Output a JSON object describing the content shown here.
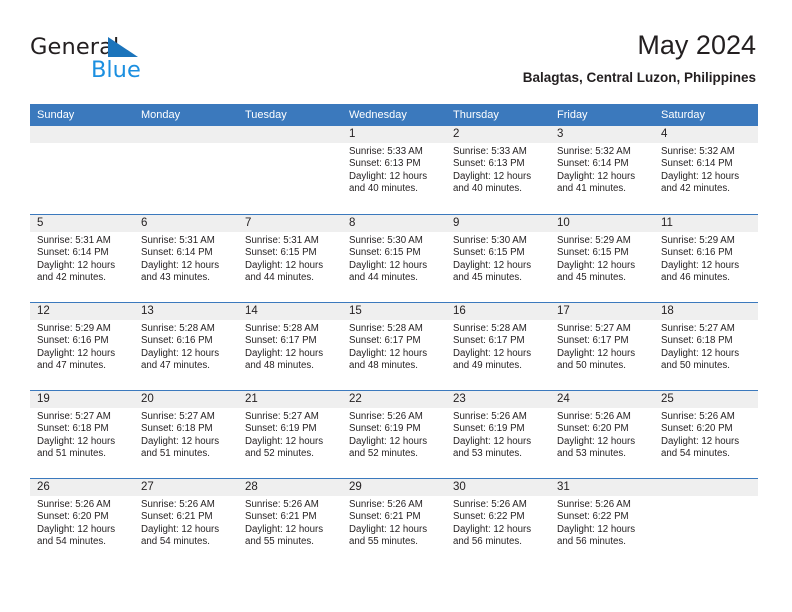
{
  "brand": {
    "name_part1": "General",
    "name_part2": "Blue",
    "triangle_color": "#1b74bb",
    "blue_color": "#1b8fe0"
  },
  "header": {
    "title": "May 2024",
    "subtitle": "Balagtas, Central Luzon, Philippines"
  },
  "theme": {
    "header_row_bg": "#3b79bd",
    "day_head_bg": "#efefef",
    "text_color": "#231f20"
  },
  "weekdays": [
    "Sunday",
    "Monday",
    "Tuesday",
    "Wednesday",
    "Thursday",
    "Friday",
    "Saturday"
  ],
  "weeks": [
    [
      {
        "day": "",
        "sunrise": "",
        "sunset": "",
        "daylight_line1": "",
        "daylight_line2": ""
      },
      {
        "day": "",
        "sunrise": "",
        "sunset": "",
        "daylight_line1": "",
        "daylight_line2": ""
      },
      {
        "day": "",
        "sunrise": "",
        "sunset": "",
        "daylight_line1": "",
        "daylight_line2": ""
      },
      {
        "day": "1",
        "sunrise": "Sunrise: 5:33 AM",
        "sunset": "Sunset: 6:13 PM",
        "daylight_line1": "Daylight: 12 hours",
        "daylight_line2": "and 40 minutes."
      },
      {
        "day": "2",
        "sunrise": "Sunrise: 5:33 AM",
        "sunset": "Sunset: 6:13 PM",
        "daylight_line1": "Daylight: 12 hours",
        "daylight_line2": "and 40 minutes."
      },
      {
        "day": "3",
        "sunrise": "Sunrise: 5:32 AM",
        "sunset": "Sunset: 6:14 PM",
        "daylight_line1": "Daylight: 12 hours",
        "daylight_line2": "and 41 minutes."
      },
      {
        "day": "4",
        "sunrise": "Sunrise: 5:32 AM",
        "sunset": "Sunset: 6:14 PM",
        "daylight_line1": "Daylight: 12 hours",
        "daylight_line2": "and 42 minutes."
      }
    ],
    [
      {
        "day": "5",
        "sunrise": "Sunrise: 5:31 AM",
        "sunset": "Sunset: 6:14 PM",
        "daylight_line1": "Daylight: 12 hours",
        "daylight_line2": "and 42 minutes."
      },
      {
        "day": "6",
        "sunrise": "Sunrise: 5:31 AM",
        "sunset": "Sunset: 6:14 PM",
        "daylight_line1": "Daylight: 12 hours",
        "daylight_line2": "and 43 minutes."
      },
      {
        "day": "7",
        "sunrise": "Sunrise: 5:31 AM",
        "sunset": "Sunset: 6:15 PM",
        "daylight_line1": "Daylight: 12 hours",
        "daylight_line2": "and 44 minutes."
      },
      {
        "day": "8",
        "sunrise": "Sunrise: 5:30 AM",
        "sunset": "Sunset: 6:15 PM",
        "daylight_line1": "Daylight: 12 hours",
        "daylight_line2": "and 44 minutes."
      },
      {
        "day": "9",
        "sunrise": "Sunrise: 5:30 AM",
        "sunset": "Sunset: 6:15 PM",
        "daylight_line1": "Daylight: 12 hours",
        "daylight_line2": "and 45 minutes."
      },
      {
        "day": "10",
        "sunrise": "Sunrise: 5:29 AM",
        "sunset": "Sunset: 6:15 PM",
        "daylight_line1": "Daylight: 12 hours",
        "daylight_line2": "and 45 minutes."
      },
      {
        "day": "11",
        "sunrise": "Sunrise: 5:29 AM",
        "sunset": "Sunset: 6:16 PM",
        "daylight_line1": "Daylight: 12 hours",
        "daylight_line2": "and 46 minutes."
      }
    ],
    [
      {
        "day": "12",
        "sunrise": "Sunrise: 5:29 AM",
        "sunset": "Sunset: 6:16 PM",
        "daylight_line1": "Daylight: 12 hours",
        "daylight_line2": "and 47 minutes."
      },
      {
        "day": "13",
        "sunrise": "Sunrise: 5:28 AM",
        "sunset": "Sunset: 6:16 PM",
        "daylight_line1": "Daylight: 12 hours",
        "daylight_line2": "and 47 minutes."
      },
      {
        "day": "14",
        "sunrise": "Sunrise: 5:28 AM",
        "sunset": "Sunset: 6:17 PM",
        "daylight_line1": "Daylight: 12 hours",
        "daylight_line2": "and 48 minutes."
      },
      {
        "day": "15",
        "sunrise": "Sunrise: 5:28 AM",
        "sunset": "Sunset: 6:17 PM",
        "daylight_line1": "Daylight: 12 hours",
        "daylight_line2": "and 48 minutes."
      },
      {
        "day": "16",
        "sunrise": "Sunrise: 5:28 AM",
        "sunset": "Sunset: 6:17 PM",
        "daylight_line1": "Daylight: 12 hours",
        "daylight_line2": "and 49 minutes."
      },
      {
        "day": "17",
        "sunrise": "Sunrise: 5:27 AM",
        "sunset": "Sunset: 6:17 PM",
        "daylight_line1": "Daylight: 12 hours",
        "daylight_line2": "and 50 minutes."
      },
      {
        "day": "18",
        "sunrise": "Sunrise: 5:27 AM",
        "sunset": "Sunset: 6:18 PM",
        "daylight_line1": "Daylight: 12 hours",
        "daylight_line2": "and 50 minutes."
      }
    ],
    [
      {
        "day": "19",
        "sunrise": "Sunrise: 5:27 AM",
        "sunset": "Sunset: 6:18 PM",
        "daylight_line1": "Daylight: 12 hours",
        "daylight_line2": "and 51 minutes."
      },
      {
        "day": "20",
        "sunrise": "Sunrise: 5:27 AM",
        "sunset": "Sunset: 6:18 PM",
        "daylight_line1": "Daylight: 12 hours",
        "daylight_line2": "and 51 minutes."
      },
      {
        "day": "21",
        "sunrise": "Sunrise: 5:27 AM",
        "sunset": "Sunset: 6:19 PM",
        "daylight_line1": "Daylight: 12 hours",
        "daylight_line2": "and 52 minutes."
      },
      {
        "day": "22",
        "sunrise": "Sunrise: 5:26 AM",
        "sunset": "Sunset: 6:19 PM",
        "daylight_line1": "Daylight: 12 hours",
        "daylight_line2": "and 52 minutes."
      },
      {
        "day": "23",
        "sunrise": "Sunrise: 5:26 AM",
        "sunset": "Sunset: 6:19 PM",
        "daylight_line1": "Daylight: 12 hours",
        "daylight_line2": "and 53 minutes."
      },
      {
        "day": "24",
        "sunrise": "Sunrise: 5:26 AM",
        "sunset": "Sunset: 6:20 PM",
        "daylight_line1": "Daylight: 12 hours",
        "daylight_line2": "and 53 minutes."
      },
      {
        "day": "25",
        "sunrise": "Sunrise: 5:26 AM",
        "sunset": "Sunset: 6:20 PM",
        "daylight_line1": "Daylight: 12 hours",
        "daylight_line2": "and 54 minutes."
      }
    ],
    [
      {
        "day": "26",
        "sunrise": "Sunrise: 5:26 AM",
        "sunset": "Sunset: 6:20 PM",
        "daylight_line1": "Daylight: 12 hours",
        "daylight_line2": "and 54 minutes."
      },
      {
        "day": "27",
        "sunrise": "Sunrise: 5:26 AM",
        "sunset": "Sunset: 6:21 PM",
        "daylight_line1": "Daylight: 12 hours",
        "daylight_line2": "and 54 minutes."
      },
      {
        "day": "28",
        "sunrise": "Sunrise: 5:26 AM",
        "sunset": "Sunset: 6:21 PM",
        "daylight_line1": "Daylight: 12 hours",
        "daylight_line2": "and 55 minutes."
      },
      {
        "day": "29",
        "sunrise": "Sunrise: 5:26 AM",
        "sunset": "Sunset: 6:21 PM",
        "daylight_line1": "Daylight: 12 hours",
        "daylight_line2": "and 55 minutes."
      },
      {
        "day": "30",
        "sunrise": "Sunrise: 5:26 AM",
        "sunset": "Sunset: 6:22 PM",
        "daylight_line1": "Daylight: 12 hours",
        "daylight_line2": "and 56 minutes."
      },
      {
        "day": "31",
        "sunrise": "Sunrise: 5:26 AM",
        "sunset": "Sunset: 6:22 PM",
        "daylight_line1": "Daylight: 12 hours",
        "daylight_line2": "and 56 minutes."
      },
      {
        "day": "",
        "sunrise": "",
        "sunset": "",
        "daylight_line1": "",
        "daylight_line2": ""
      }
    ]
  ]
}
